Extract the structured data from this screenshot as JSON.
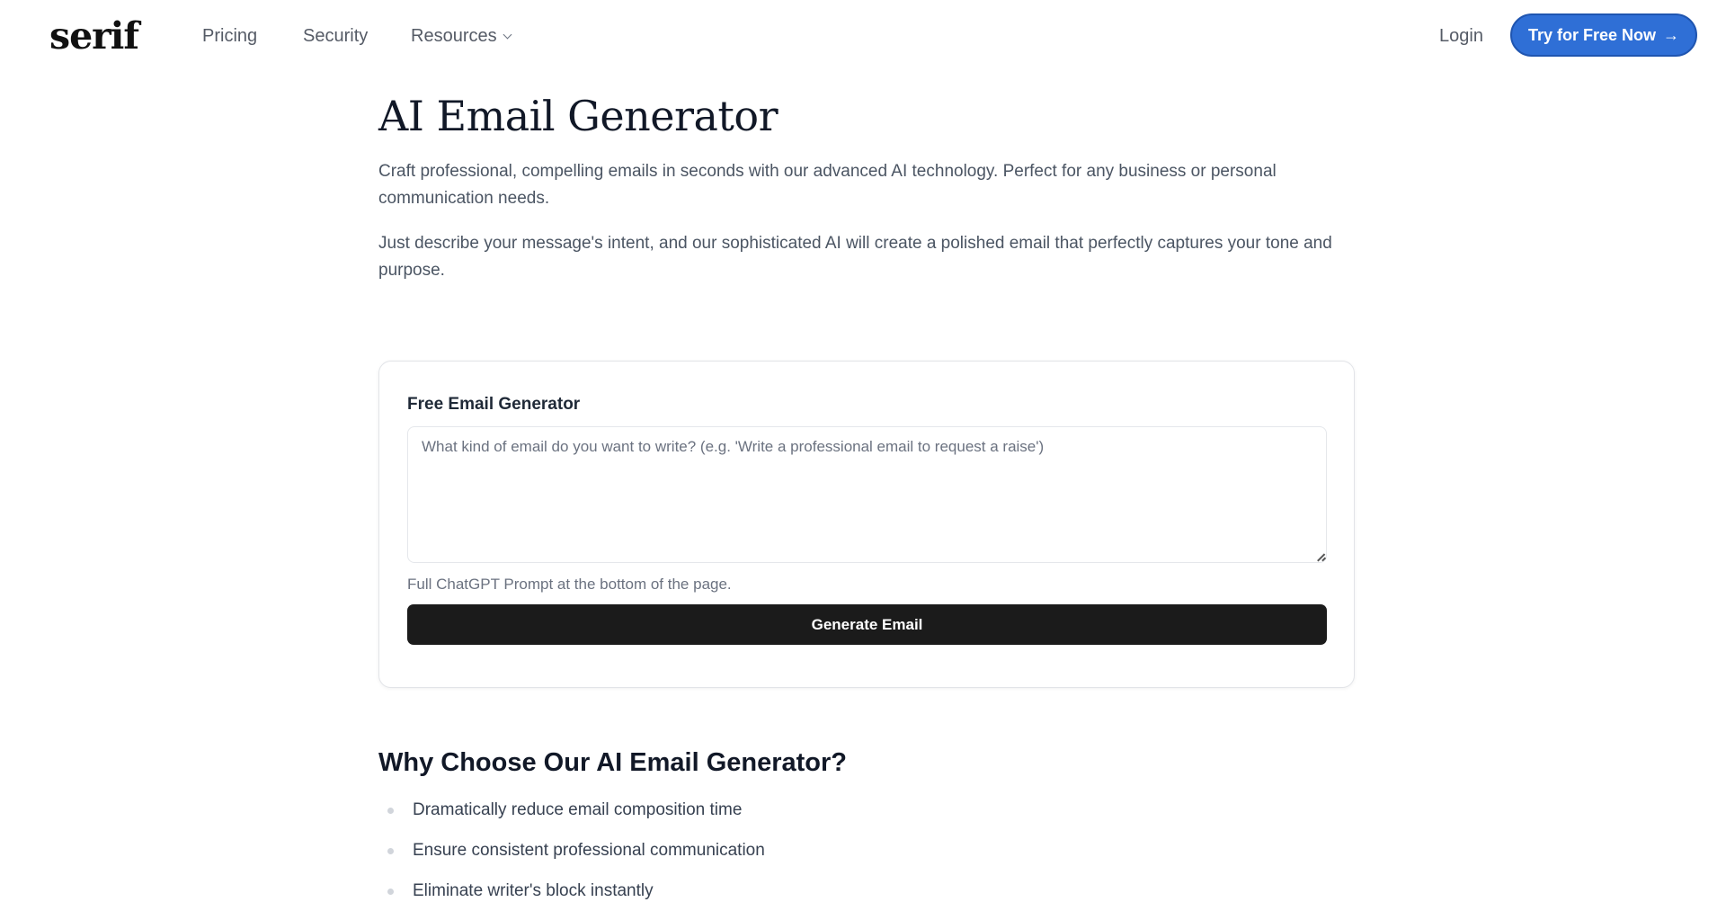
{
  "nav": {
    "logo": "serif",
    "links": [
      "Pricing",
      "Security",
      "Resources"
    ],
    "login": "Login",
    "cta": "Try for Free Now",
    "cta_icon": "arrow-right-icon",
    "accent_color": "#2f6fd6"
  },
  "hero": {
    "title": "AI Email Generator",
    "paragraph1": "Craft professional, compelling emails in seconds with our advanced AI technology. Perfect for any business or personal communication needs.",
    "paragraph2": "Just describe your message's intent, and our sophisticated AI will create a polished email that perfectly captures your tone and purpose."
  },
  "generator": {
    "title": "Free Email Generator",
    "input_value": "",
    "placeholder": "What kind of email do you want to write? (e.g. 'Write a professional email to request a raise')",
    "hint": "Full ChatGPT Prompt at the bottom of the page.",
    "button": "Generate Email"
  },
  "why": {
    "title": "Why Choose Our AI Email Generator?",
    "items": [
      "Dramatically reduce email composition time",
      "Ensure consistent professional communication",
      "Eliminate writer's block instantly"
    ]
  }
}
